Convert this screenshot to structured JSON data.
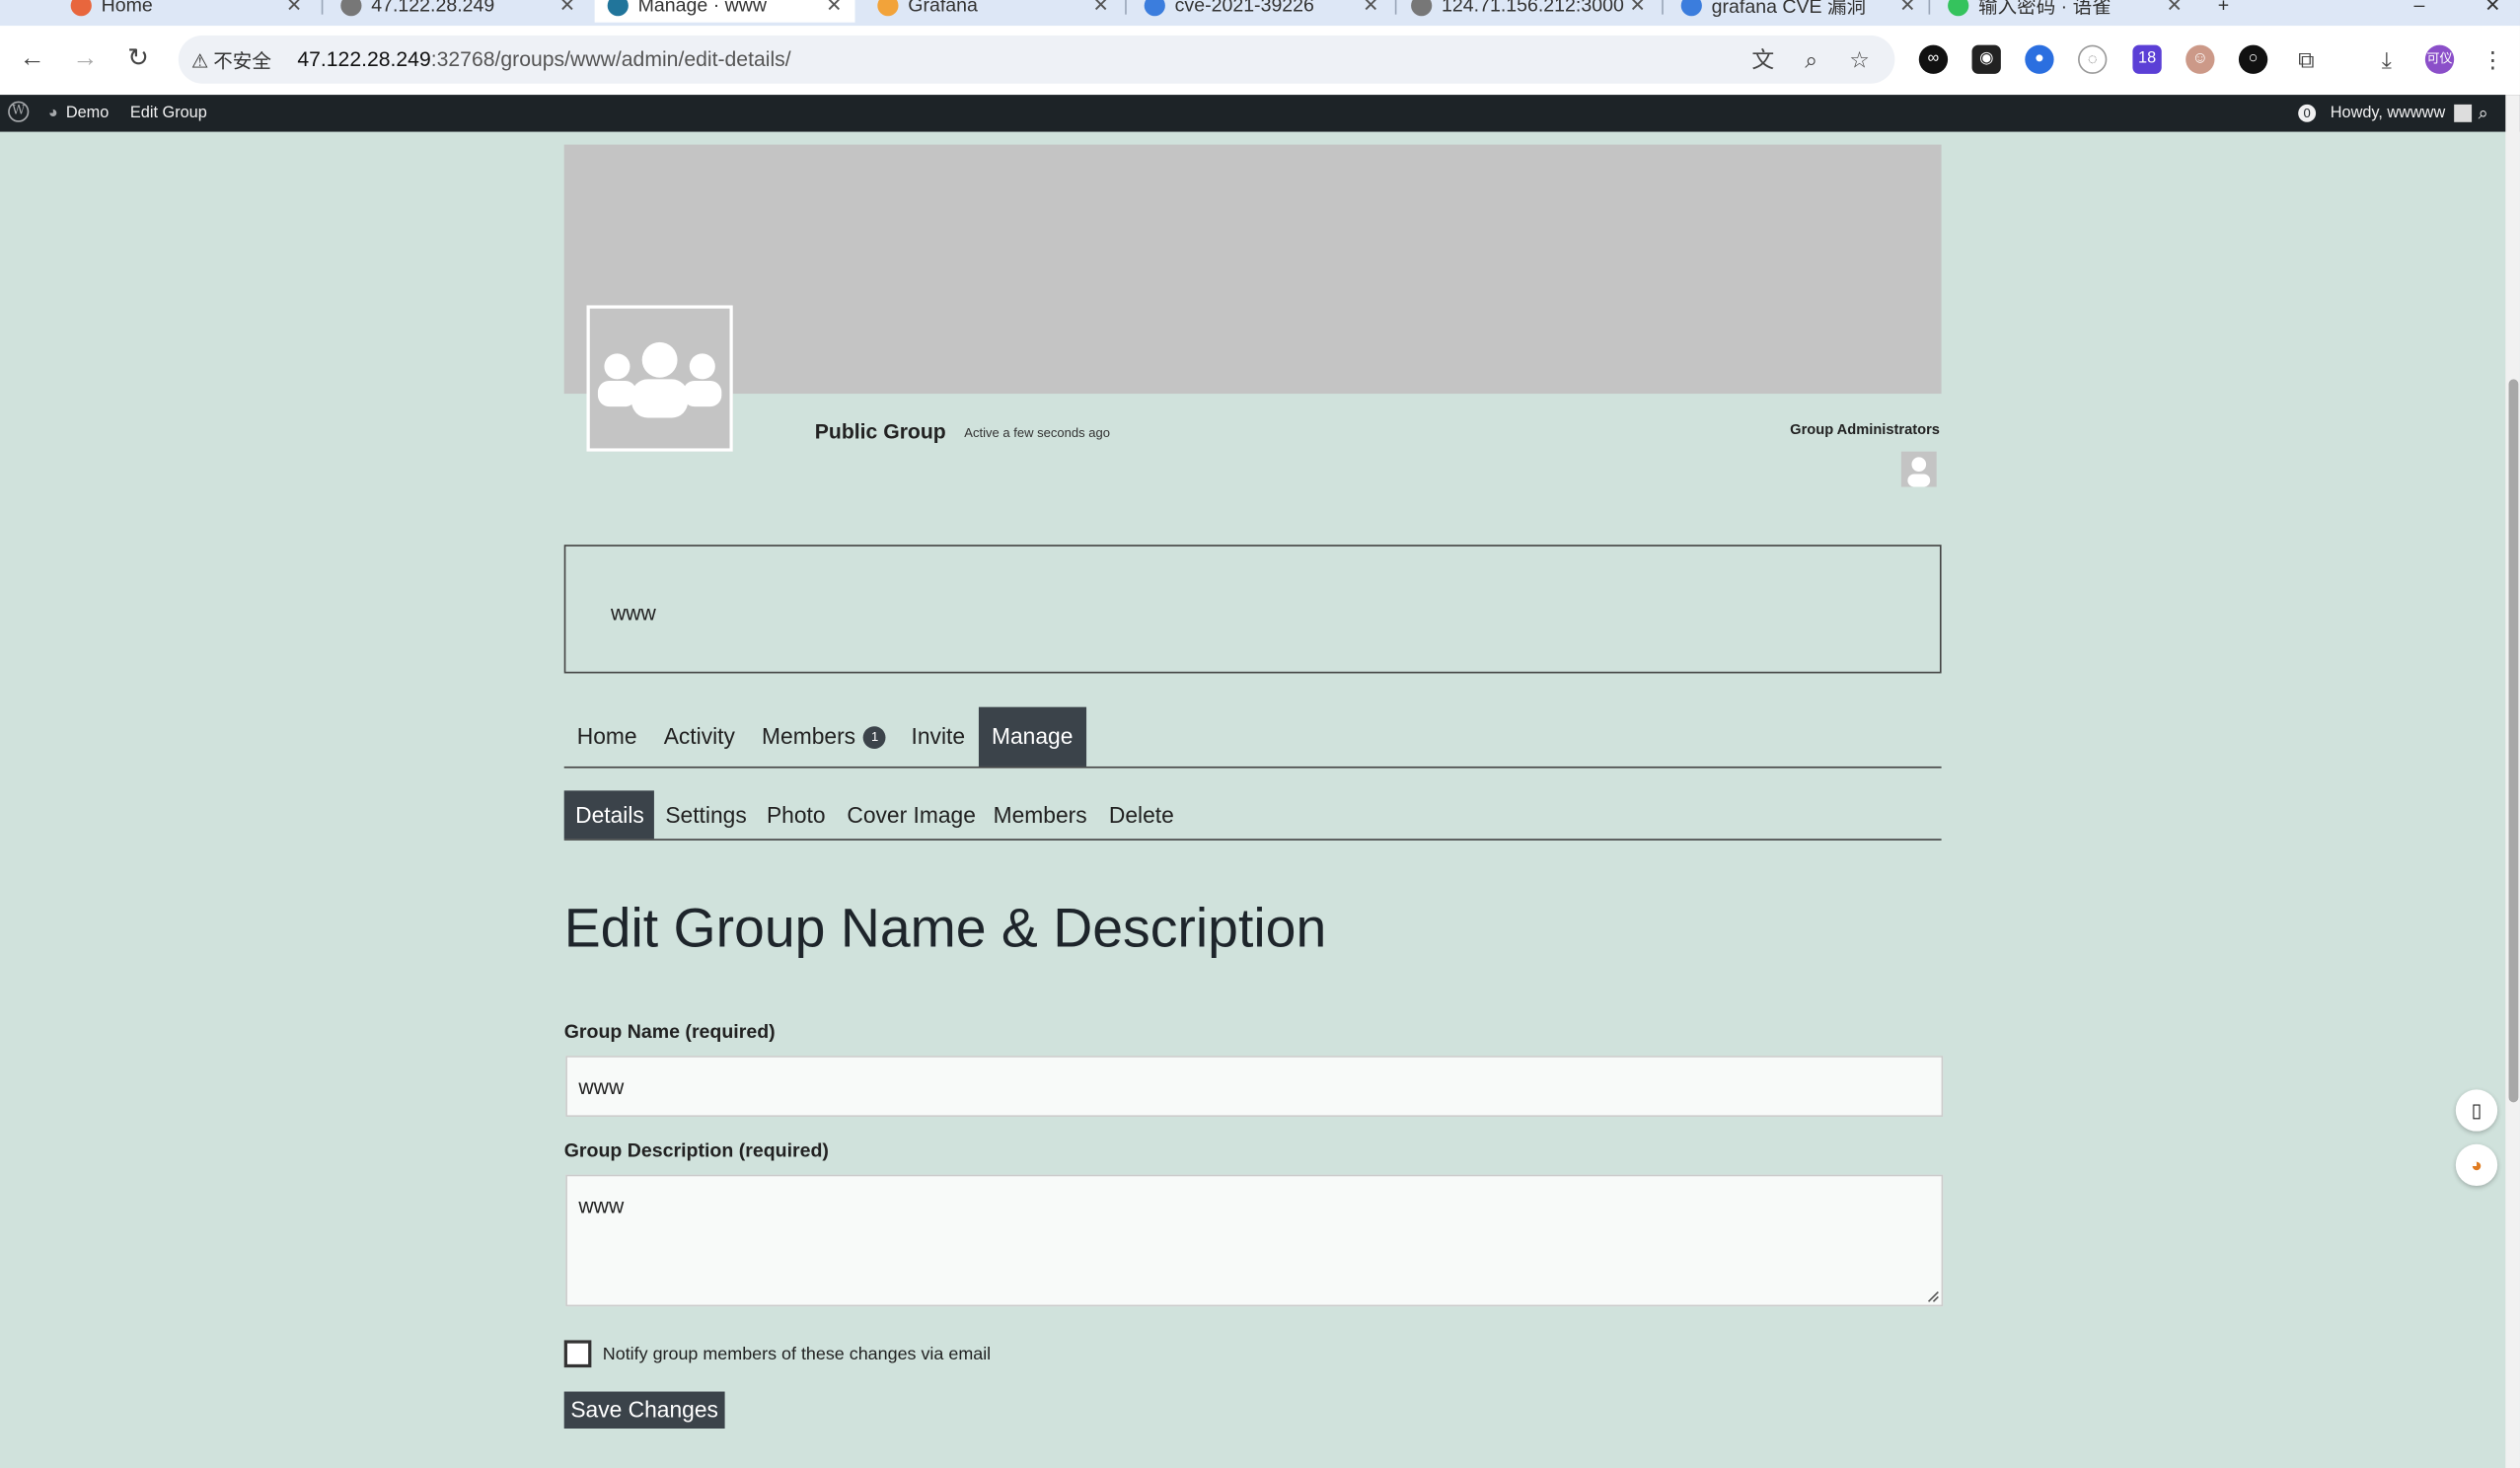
{
  "browser": {
    "tabs": [
      {
        "title": "Home"
      },
      {
        "title": "47.122.28.249"
      },
      {
        "title": "Manage · www"
      },
      {
        "title": "Grafana"
      },
      {
        "title": "cve-2021-39226"
      },
      {
        "title": "124.71.156.212:3000"
      },
      {
        "title": "grafana CVE 漏洞"
      },
      {
        "title": "输入密码 · 语雀"
      }
    ],
    "security_label": "不安全",
    "url_host": "47.122.28.249",
    "url_path": ":32768/groups/www/admin/edit-details/",
    "extension_badge": "18",
    "profile_label": "可仪"
  },
  "adminbar": {
    "site_name": "Demo",
    "edit_group": "Edit Group",
    "notifications": "0",
    "howdy": "Howdy, wwwww"
  },
  "group": {
    "name": "Public Group",
    "activity": "Active a few seconds ago",
    "admins_title": "Group Administrators",
    "description": "www"
  },
  "main_nav": [
    {
      "label": "Home"
    },
    {
      "label": "Activity"
    },
    {
      "label": "Members",
      "count": "1"
    },
    {
      "label": "Invite"
    },
    {
      "label": "Manage"
    }
  ],
  "sub_nav": [
    {
      "label": "Details"
    },
    {
      "label": "Settings"
    },
    {
      "label": "Photo"
    },
    {
      "label": "Cover Image"
    },
    {
      "label": "Members"
    },
    {
      "label": "Delete"
    }
  ],
  "form": {
    "title": "Edit Group Name & Description",
    "name_label": "Group Name (required)",
    "name_value": "www",
    "desc_label": "Group Description (required)",
    "desc_value": "www",
    "notify_label": "Notify group members of these changes via email",
    "save_label": "Save Changes"
  }
}
